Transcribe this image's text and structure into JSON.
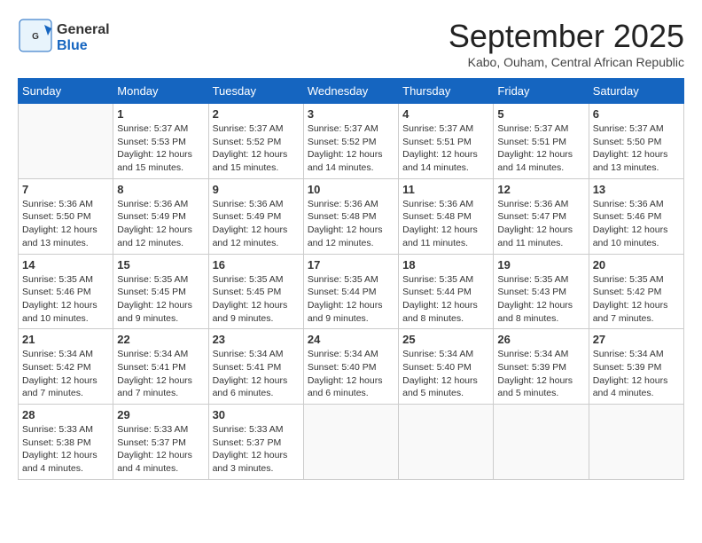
{
  "logo": {
    "text_general": "General",
    "text_blue": "Blue"
  },
  "header": {
    "month_title": "September 2025",
    "subtitle": "Kabo, Ouham, Central African Republic"
  },
  "days_of_week": [
    "Sunday",
    "Monday",
    "Tuesday",
    "Wednesday",
    "Thursday",
    "Friday",
    "Saturday"
  ],
  "weeks": [
    [
      {
        "day": "",
        "info": ""
      },
      {
        "day": "1",
        "info": "Sunrise: 5:37 AM\nSunset: 5:53 PM\nDaylight: 12 hours\nand 15 minutes."
      },
      {
        "day": "2",
        "info": "Sunrise: 5:37 AM\nSunset: 5:52 PM\nDaylight: 12 hours\nand 15 minutes."
      },
      {
        "day": "3",
        "info": "Sunrise: 5:37 AM\nSunset: 5:52 PM\nDaylight: 12 hours\nand 14 minutes."
      },
      {
        "day": "4",
        "info": "Sunrise: 5:37 AM\nSunset: 5:51 PM\nDaylight: 12 hours\nand 14 minutes."
      },
      {
        "day": "5",
        "info": "Sunrise: 5:37 AM\nSunset: 5:51 PM\nDaylight: 12 hours\nand 14 minutes."
      },
      {
        "day": "6",
        "info": "Sunrise: 5:37 AM\nSunset: 5:50 PM\nDaylight: 12 hours\nand 13 minutes."
      }
    ],
    [
      {
        "day": "7",
        "info": "Sunrise: 5:36 AM\nSunset: 5:50 PM\nDaylight: 12 hours\nand 13 minutes."
      },
      {
        "day": "8",
        "info": "Sunrise: 5:36 AM\nSunset: 5:49 PM\nDaylight: 12 hours\nand 12 minutes."
      },
      {
        "day": "9",
        "info": "Sunrise: 5:36 AM\nSunset: 5:49 PM\nDaylight: 12 hours\nand 12 minutes."
      },
      {
        "day": "10",
        "info": "Sunrise: 5:36 AM\nSunset: 5:48 PM\nDaylight: 12 hours\nand 12 minutes."
      },
      {
        "day": "11",
        "info": "Sunrise: 5:36 AM\nSunset: 5:48 PM\nDaylight: 12 hours\nand 11 minutes."
      },
      {
        "day": "12",
        "info": "Sunrise: 5:36 AM\nSunset: 5:47 PM\nDaylight: 12 hours\nand 11 minutes."
      },
      {
        "day": "13",
        "info": "Sunrise: 5:36 AM\nSunset: 5:46 PM\nDaylight: 12 hours\nand 10 minutes."
      }
    ],
    [
      {
        "day": "14",
        "info": "Sunrise: 5:35 AM\nSunset: 5:46 PM\nDaylight: 12 hours\nand 10 minutes."
      },
      {
        "day": "15",
        "info": "Sunrise: 5:35 AM\nSunset: 5:45 PM\nDaylight: 12 hours\nand 9 minutes."
      },
      {
        "day": "16",
        "info": "Sunrise: 5:35 AM\nSunset: 5:45 PM\nDaylight: 12 hours\nand 9 minutes."
      },
      {
        "day": "17",
        "info": "Sunrise: 5:35 AM\nSunset: 5:44 PM\nDaylight: 12 hours\nand 9 minutes."
      },
      {
        "day": "18",
        "info": "Sunrise: 5:35 AM\nSunset: 5:44 PM\nDaylight: 12 hours\nand 8 minutes."
      },
      {
        "day": "19",
        "info": "Sunrise: 5:35 AM\nSunset: 5:43 PM\nDaylight: 12 hours\nand 8 minutes."
      },
      {
        "day": "20",
        "info": "Sunrise: 5:35 AM\nSunset: 5:42 PM\nDaylight: 12 hours\nand 7 minutes."
      }
    ],
    [
      {
        "day": "21",
        "info": "Sunrise: 5:34 AM\nSunset: 5:42 PM\nDaylight: 12 hours\nand 7 minutes."
      },
      {
        "day": "22",
        "info": "Sunrise: 5:34 AM\nSunset: 5:41 PM\nDaylight: 12 hours\nand 7 minutes."
      },
      {
        "day": "23",
        "info": "Sunrise: 5:34 AM\nSunset: 5:41 PM\nDaylight: 12 hours\nand 6 minutes."
      },
      {
        "day": "24",
        "info": "Sunrise: 5:34 AM\nSunset: 5:40 PM\nDaylight: 12 hours\nand 6 minutes."
      },
      {
        "day": "25",
        "info": "Sunrise: 5:34 AM\nSunset: 5:40 PM\nDaylight: 12 hours\nand 5 minutes."
      },
      {
        "day": "26",
        "info": "Sunrise: 5:34 AM\nSunset: 5:39 PM\nDaylight: 12 hours\nand 5 minutes."
      },
      {
        "day": "27",
        "info": "Sunrise: 5:34 AM\nSunset: 5:39 PM\nDaylight: 12 hours\nand 4 minutes."
      }
    ],
    [
      {
        "day": "28",
        "info": "Sunrise: 5:33 AM\nSunset: 5:38 PM\nDaylight: 12 hours\nand 4 minutes."
      },
      {
        "day": "29",
        "info": "Sunrise: 5:33 AM\nSunset: 5:37 PM\nDaylight: 12 hours\nand 4 minutes."
      },
      {
        "day": "30",
        "info": "Sunrise: 5:33 AM\nSunset: 5:37 PM\nDaylight: 12 hours\nand 3 minutes."
      },
      {
        "day": "",
        "info": ""
      },
      {
        "day": "",
        "info": ""
      },
      {
        "day": "",
        "info": ""
      },
      {
        "day": "",
        "info": ""
      }
    ]
  ]
}
